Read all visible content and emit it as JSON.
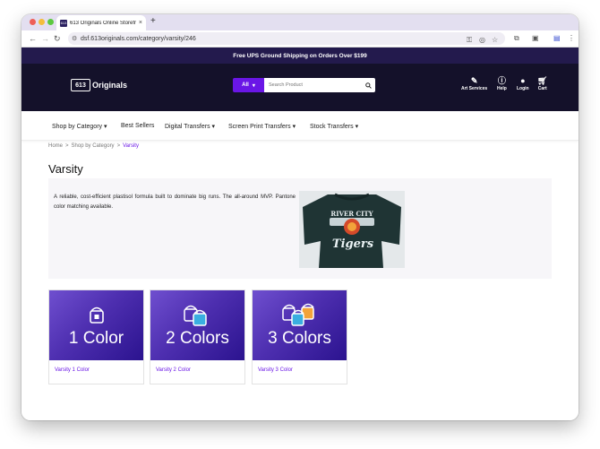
{
  "browser": {
    "tab_title": "613 Originals Online Storefro",
    "favicon_text": "613",
    "tab_close": "×",
    "new_tab": "+",
    "url": "dsf.613originals.com/category/varsity/246"
  },
  "promo": {
    "text": "Free UPS Ground Shipping on Orders Over $199"
  },
  "header": {
    "logo_mark": "613",
    "logo_name": "Originals",
    "search": {
      "category_label": "All",
      "placeholder": "Search Product"
    },
    "links": [
      {
        "label": "Art Services",
        "icon": "brush-icon"
      },
      {
        "label": "Help",
        "icon": "info-icon"
      },
      {
        "label": "Login",
        "icon": "user-icon"
      },
      {
        "label": "Cart",
        "icon": "cart-icon"
      }
    ]
  },
  "nav": {
    "items": [
      {
        "label": "Shop by Category ▾"
      },
      {
        "label": "Best Sellers"
      },
      {
        "label": "Digital Transfers ▾"
      },
      {
        "label": "Screen Print Transfers ▾"
      },
      {
        "label": "Stock Transfers ▾"
      }
    ]
  },
  "breadcrumb": {
    "home": "Home",
    "sep": ">",
    "category": "Shop by Category",
    "current": "Varsity"
  },
  "page": {
    "title": "Varsity",
    "description": "A reliable, cost-efficient plastisol formula built to dominate big runs. The all-around MVP. Pantone color matching available.",
    "image_text_top": "RIVER CITY",
    "image_text_mid": "Tigers"
  },
  "cards": [
    {
      "banner_text": "1 Color",
      "caption": "Varsity 1 Color"
    },
    {
      "banner_text": "2 Colors",
      "caption": "Varsity 2 Color"
    },
    {
      "banner_text": "3 Colors",
      "caption": "Varsity 3 Color"
    }
  ],
  "colors": {
    "brand_purple": "#6a16e6",
    "header_dark": "#14112a",
    "promo_bar": "#231a4d"
  }
}
